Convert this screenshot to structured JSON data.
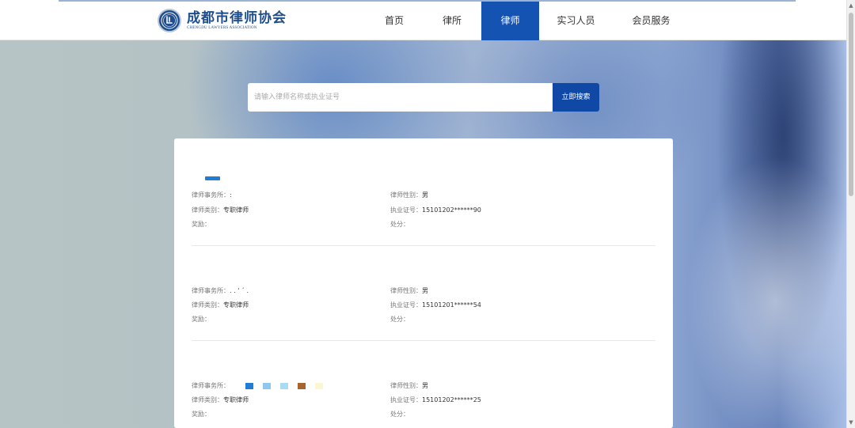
{
  "header": {
    "logo_cn": "成都市律师协会",
    "logo_en": "CHENGDU LAWYERS ASSOCIATION",
    "nav": [
      {
        "label": "首页",
        "active": false
      },
      {
        "label": "律所",
        "active": false
      },
      {
        "label": "律师",
        "active": true
      },
      {
        "label": "实习人员",
        "active": false
      },
      {
        "label": "会员服务",
        "active": false
      }
    ]
  },
  "search": {
    "placeholder": "请输入律师名称或执业证号",
    "button_label": "立即搜索"
  },
  "lawyers": [
    {
      "firm_label": "律师事务所：",
      "firm_value": ":",
      "gender_label": "律师性别：",
      "gender": "男",
      "type_label": "律师类别：",
      "type": "专职律师",
      "license_label": "执业证号：",
      "license": "15101202******90",
      "award_label": "奖励：",
      "punish_label": "处分："
    },
    {
      "firm_label": "律师事务所：",
      "firm_value": ". .   '     ´             .",
      "gender_label": "律师性别：",
      "gender": "男",
      "type_label": "律师类别：",
      "type": "专职律师",
      "license_label": "执业证号：",
      "license": "15101201******54",
      "award_label": "奖励：",
      "punish_label": "处分："
    },
    {
      "firm_label": "律师事务所：",
      "firm_value": "",
      "gender_label": "律师性别：",
      "gender": "男",
      "type_label": "律师类别：",
      "type": "专职律师",
      "license_label": "执业证号：",
      "license": "15101202******25",
      "award_label": "奖励：",
      "punish_label": "处分："
    }
  ],
  "colors": {
    "brand": "#1f4e8f",
    "nav_active": "#1553b2",
    "search_button": "#0f49a5",
    "redaction_marks": [
      "#1f7dd3",
      "#8ec8ef",
      "#a9dbf3",
      "#a5652d",
      "#fbf6d3"
    ]
  },
  "icons": [
    "association-emblem-icon",
    "scroll-up-icon",
    "scroll-down-icon"
  ]
}
